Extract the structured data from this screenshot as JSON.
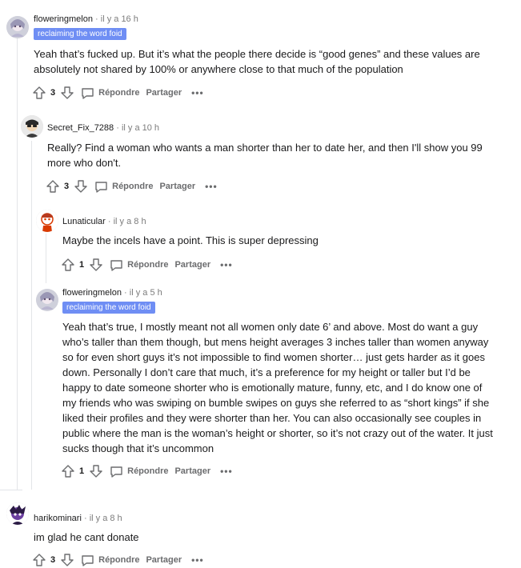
{
  "labels": {
    "reply": "Répondre",
    "share": "Partager"
  },
  "comments": [
    {
      "user": "floweringmelon",
      "time": "· il y a 16 h",
      "flair": "reclaiming the word foid",
      "text": "Yeah that’s fucked up. But it’s what the people there decide is “good genes” and these values are absolutely not shared by 100% or anywhere close to that much of the population",
      "votes": "3"
    },
    {
      "user": "Secret_Fix_7288",
      "time": "· il y a 10 h",
      "text": "Really? Find a woman who wants a man shorter than her to date her, and then I'll show you 99 more who don't.",
      "votes": "3"
    },
    {
      "user": "Lunaticular",
      "time": "· il y a 8 h",
      "text": "Maybe the incels have a point. This is super depressing",
      "votes": "1"
    },
    {
      "user": "floweringmelon",
      "time": "· il y a 5 h",
      "flair": "reclaiming the word foid",
      "text": "Yeah that’s true, I mostly meant not all women only date 6’ and above. Most do want a guy who’s taller than them though, but mens height averages 3 inches taller than women anyway so for even short guys it’s not impossible to find women shorter… just gets harder as it goes down. Personally I don’t care that much, it’s a preference for my height or taller but I’d be happy to date someone shorter who is emotionally mature, funny, etc, and I do know one of my friends who was swiping on bumble swipes on guys she referred to as “short kings” if she liked their profiles and they were shorter than her. You can also occasionally see couples in public where the man is the woman’s height or shorter, so it’s not crazy out of the water. It just sucks though that it’s uncommon",
      "votes": "1"
    },
    {
      "user": "harikominari",
      "time": "· il y a 8 h",
      "text": "im glad he cant donate",
      "votes": "3"
    }
  ]
}
